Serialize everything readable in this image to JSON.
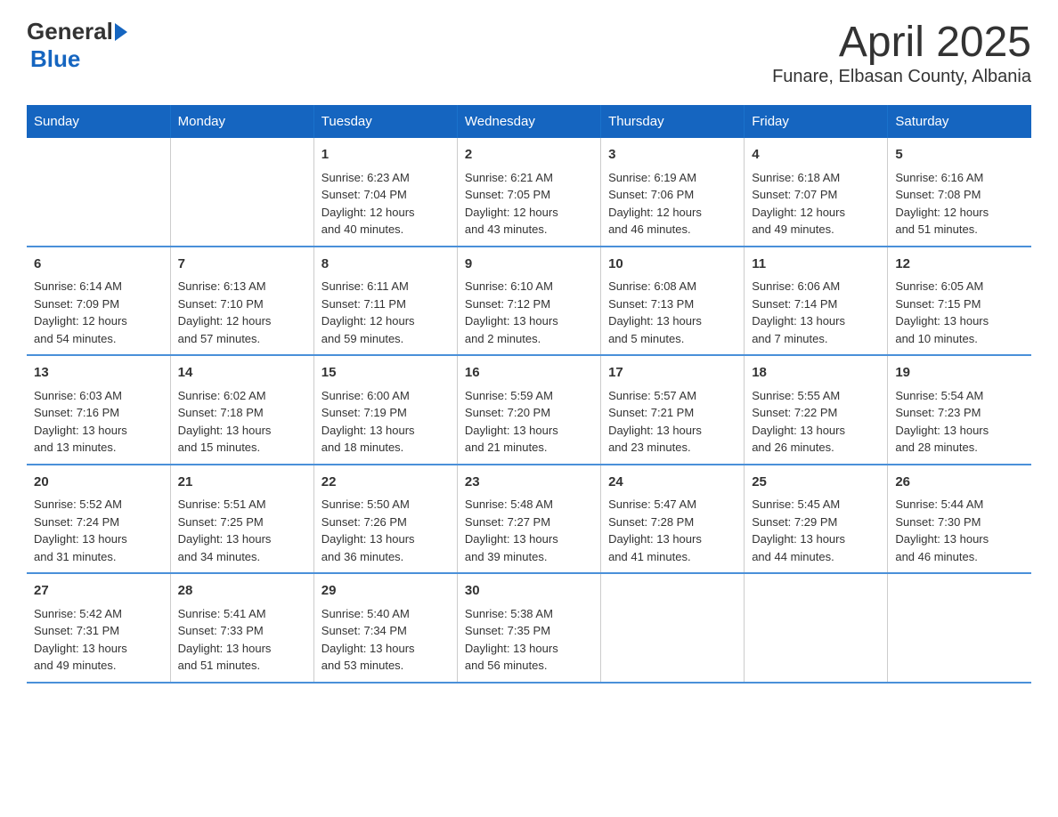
{
  "logo": {
    "general": "General",
    "blue": "Blue"
  },
  "title": "April 2025",
  "location": "Funare, Elbasan County, Albania",
  "days_of_week": [
    "Sunday",
    "Monday",
    "Tuesday",
    "Wednesday",
    "Thursday",
    "Friday",
    "Saturday"
  ],
  "weeks": [
    [
      {
        "day": "",
        "info": ""
      },
      {
        "day": "",
        "info": ""
      },
      {
        "day": "1",
        "info": "Sunrise: 6:23 AM\nSunset: 7:04 PM\nDaylight: 12 hours\nand 40 minutes."
      },
      {
        "day": "2",
        "info": "Sunrise: 6:21 AM\nSunset: 7:05 PM\nDaylight: 12 hours\nand 43 minutes."
      },
      {
        "day": "3",
        "info": "Sunrise: 6:19 AM\nSunset: 7:06 PM\nDaylight: 12 hours\nand 46 minutes."
      },
      {
        "day": "4",
        "info": "Sunrise: 6:18 AM\nSunset: 7:07 PM\nDaylight: 12 hours\nand 49 minutes."
      },
      {
        "day": "5",
        "info": "Sunrise: 6:16 AM\nSunset: 7:08 PM\nDaylight: 12 hours\nand 51 minutes."
      }
    ],
    [
      {
        "day": "6",
        "info": "Sunrise: 6:14 AM\nSunset: 7:09 PM\nDaylight: 12 hours\nand 54 minutes."
      },
      {
        "day": "7",
        "info": "Sunrise: 6:13 AM\nSunset: 7:10 PM\nDaylight: 12 hours\nand 57 minutes."
      },
      {
        "day": "8",
        "info": "Sunrise: 6:11 AM\nSunset: 7:11 PM\nDaylight: 12 hours\nand 59 minutes."
      },
      {
        "day": "9",
        "info": "Sunrise: 6:10 AM\nSunset: 7:12 PM\nDaylight: 13 hours\nand 2 minutes."
      },
      {
        "day": "10",
        "info": "Sunrise: 6:08 AM\nSunset: 7:13 PM\nDaylight: 13 hours\nand 5 minutes."
      },
      {
        "day": "11",
        "info": "Sunrise: 6:06 AM\nSunset: 7:14 PM\nDaylight: 13 hours\nand 7 minutes."
      },
      {
        "day": "12",
        "info": "Sunrise: 6:05 AM\nSunset: 7:15 PM\nDaylight: 13 hours\nand 10 minutes."
      }
    ],
    [
      {
        "day": "13",
        "info": "Sunrise: 6:03 AM\nSunset: 7:16 PM\nDaylight: 13 hours\nand 13 minutes."
      },
      {
        "day": "14",
        "info": "Sunrise: 6:02 AM\nSunset: 7:18 PM\nDaylight: 13 hours\nand 15 minutes."
      },
      {
        "day": "15",
        "info": "Sunrise: 6:00 AM\nSunset: 7:19 PM\nDaylight: 13 hours\nand 18 minutes."
      },
      {
        "day": "16",
        "info": "Sunrise: 5:59 AM\nSunset: 7:20 PM\nDaylight: 13 hours\nand 21 minutes."
      },
      {
        "day": "17",
        "info": "Sunrise: 5:57 AM\nSunset: 7:21 PM\nDaylight: 13 hours\nand 23 minutes."
      },
      {
        "day": "18",
        "info": "Sunrise: 5:55 AM\nSunset: 7:22 PM\nDaylight: 13 hours\nand 26 minutes."
      },
      {
        "day": "19",
        "info": "Sunrise: 5:54 AM\nSunset: 7:23 PM\nDaylight: 13 hours\nand 28 minutes."
      }
    ],
    [
      {
        "day": "20",
        "info": "Sunrise: 5:52 AM\nSunset: 7:24 PM\nDaylight: 13 hours\nand 31 minutes."
      },
      {
        "day": "21",
        "info": "Sunrise: 5:51 AM\nSunset: 7:25 PM\nDaylight: 13 hours\nand 34 minutes."
      },
      {
        "day": "22",
        "info": "Sunrise: 5:50 AM\nSunset: 7:26 PM\nDaylight: 13 hours\nand 36 minutes."
      },
      {
        "day": "23",
        "info": "Sunrise: 5:48 AM\nSunset: 7:27 PM\nDaylight: 13 hours\nand 39 minutes."
      },
      {
        "day": "24",
        "info": "Sunrise: 5:47 AM\nSunset: 7:28 PM\nDaylight: 13 hours\nand 41 minutes."
      },
      {
        "day": "25",
        "info": "Sunrise: 5:45 AM\nSunset: 7:29 PM\nDaylight: 13 hours\nand 44 minutes."
      },
      {
        "day": "26",
        "info": "Sunrise: 5:44 AM\nSunset: 7:30 PM\nDaylight: 13 hours\nand 46 minutes."
      }
    ],
    [
      {
        "day": "27",
        "info": "Sunrise: 5:42 AM\nSunset: 7:31 PM\nDaylight: 13 hours\nand 49 minutes."
      },
      {
        "day": "28",
        "info": "Sunrise: 5:41 AM\nSunset: 7:33 PM\nDaylight: 13 hours\nand 51 minutes."
      },
      {
        "day": "29",
        "info": "Sunrise: 5:40 AM\nSunset: 7:34 PM\nDaylight: 13 hours\nand 53 minutes."
      },
      {
        "day": "30",
        "info": "Sunrise: 5:38 AM\nSunset: 7:35 PM\nDaylight: 13 hours\nand 56 minutes."
      },
      {
        "day": "",
        "info": ""
      },
      {
        "day": "",
        "info": ""
      },
      {
        "day": "",
        "info": ""
      }
    ]
  ]
}
